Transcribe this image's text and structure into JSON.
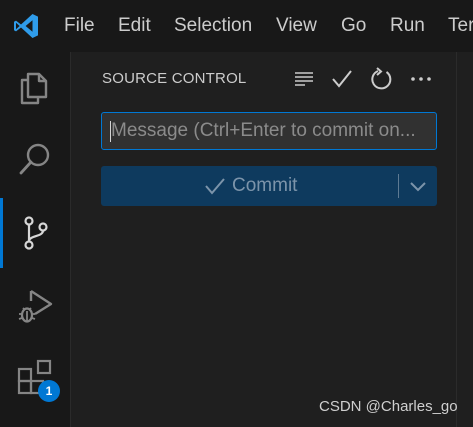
{
  "menubar": {
    "items": [
      "File",
      "Edit",
      "Selection",
      "View",
      "Go",
      "Run",
      "Ter"
    ]
  },
  "activity_bar": {
    "items": [
      {
        "name": "explorer",
        "icon": "files-icon",
        "active": false
      },
      {
        "name": "search",
        "icon": "search-icon",
        "active": false
      },
      {
        "name": "source-control",
        "icon": "source-control-icon",
        "active": true
      },
      {
        "name": "run-and-debug",
        "icon": "run-debug-icon",
        "active": false
      },
      {
        "name": "extensions",
        "icon": "extensions-icon",
        "active": false,
        "badge": "1"
      }
    ]
  },
  "source_control": {
    "title": "SOURCE CONTROL",
    "actions": [
      "view-as-tree-icon",
      "commit-check-icon",
      "refresh-icon",
      "more-actions-icon"
    ],
    "message_placeholder": "Message (Ctrl+Enter to commit on...",
    "commit_label": "Commit"
  },
  "watermark": "CSDN @Charles_go",
  "colors": {
    "accent": "#0078d4",
    "background": "#1f1f1f",
    "sidebar": "#181818",
    "commit_button": "#0e3a5e"
  }
}
